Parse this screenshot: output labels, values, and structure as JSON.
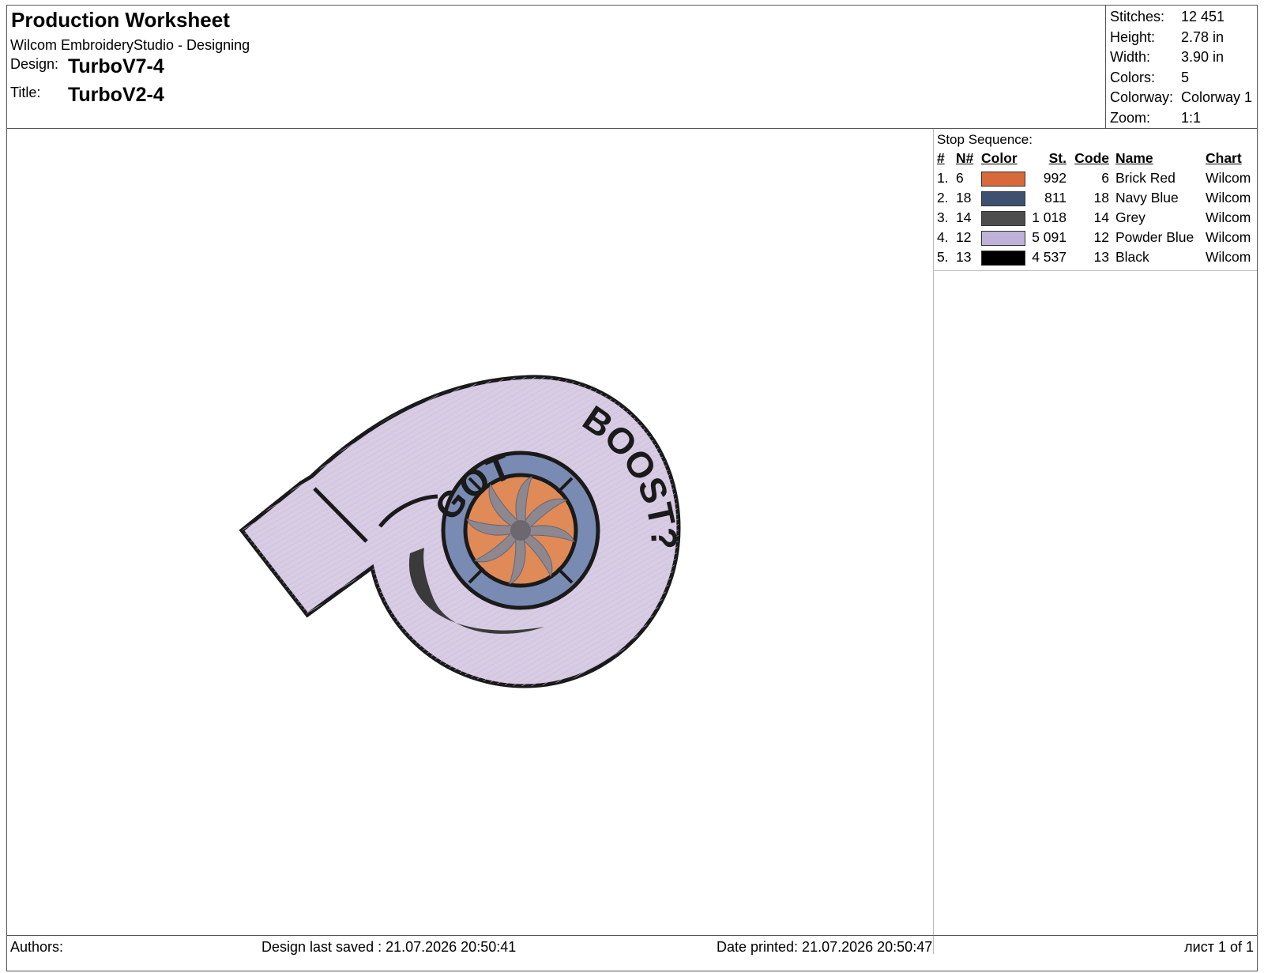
{
  "header": {
    "worksheet_title": "Production Worksheet",
    "app_line": "Wilcom EmbroideryStudio - Designing",
    "design_label": "Design:",
    "design_value": "TurboV7-4",
    "title_label": "Title:",
    "title_value": "TurboV2-4"
  },
  "stats": [
    {
      "key": "Stitches:",
      "value": "12 451"
    },
    {
      "key": "Height:",
      "value": "2.78 in"
    },
    {
      "key": "Width:",
      "value": "3.90 in"
    },
    {
      "key": "Colors:",
      "value": "5"
    },
    {
      "key": "Colorway:",
      "value": "Colorway 1"
    },
    {
      "key": "Zoom:",
      "value": "1:1"
    }
  ],
  "stop_sequence": {
    "title": "Stop Sequence:",
    "columns": [
      "#",
      "N#",
      "Color",
      "St.",
      "Code",
      "Name",
      "Chart"
    ],
    "rows": [
      {
        "num": "1.",
        "n": "6",
        "color": "#d8693a",
        "st": "992",
        "code": "6",
        "name": "Brick Red",
        "chart": "Wilcom"
      },
      {
        "num": "2.",
        "n": "18",
        "color": "#3f5170",
        "st": "811",
        "code": "18",
        "name": "Navy Blue",
        "chart": "Wilcom"
      },
      {
        "num": "3.",
        "n": "14",
        "color": "#4d4d4d",
        "st": "1 018",
        "code": "14",
        "name": "Grey",
        "chart": "Wilcom"
      },
      {
        "num": "4.",
        "n": "12",
        "color": "#bfb1d8",
        "st": "5 091",
        "code": "12",
        "name": "Powder Blue",
        "chart": "Wilcom"
      },
      {
        "num": "5.",
        "n": "13",
        "color": "#000000",
        "st": "4 537",
        "code": "13",
        "name": "Black",
        "chart": "Wilcom"
      }
    ]
  },
  "design_preview": {
    "text_top": "GOT",
    "text_side": "BOOST?",
    "colors": {
      "body": "#d8cbe4",
      "outline": "#1a1a1a",
      "ring": "#7a8bb3",
      "impeller": "#e08a58",
      "blades": "#8d8790"
    }
  },
  "footer": {
    "authors": "Authors:",
    "last_saved": "Design last saved : 21.07.2026 20:50:41",
    "printed": "Date printed: 21.07.2026 20:50:47",
    "page": "лист 1 of 1"
  }
}
